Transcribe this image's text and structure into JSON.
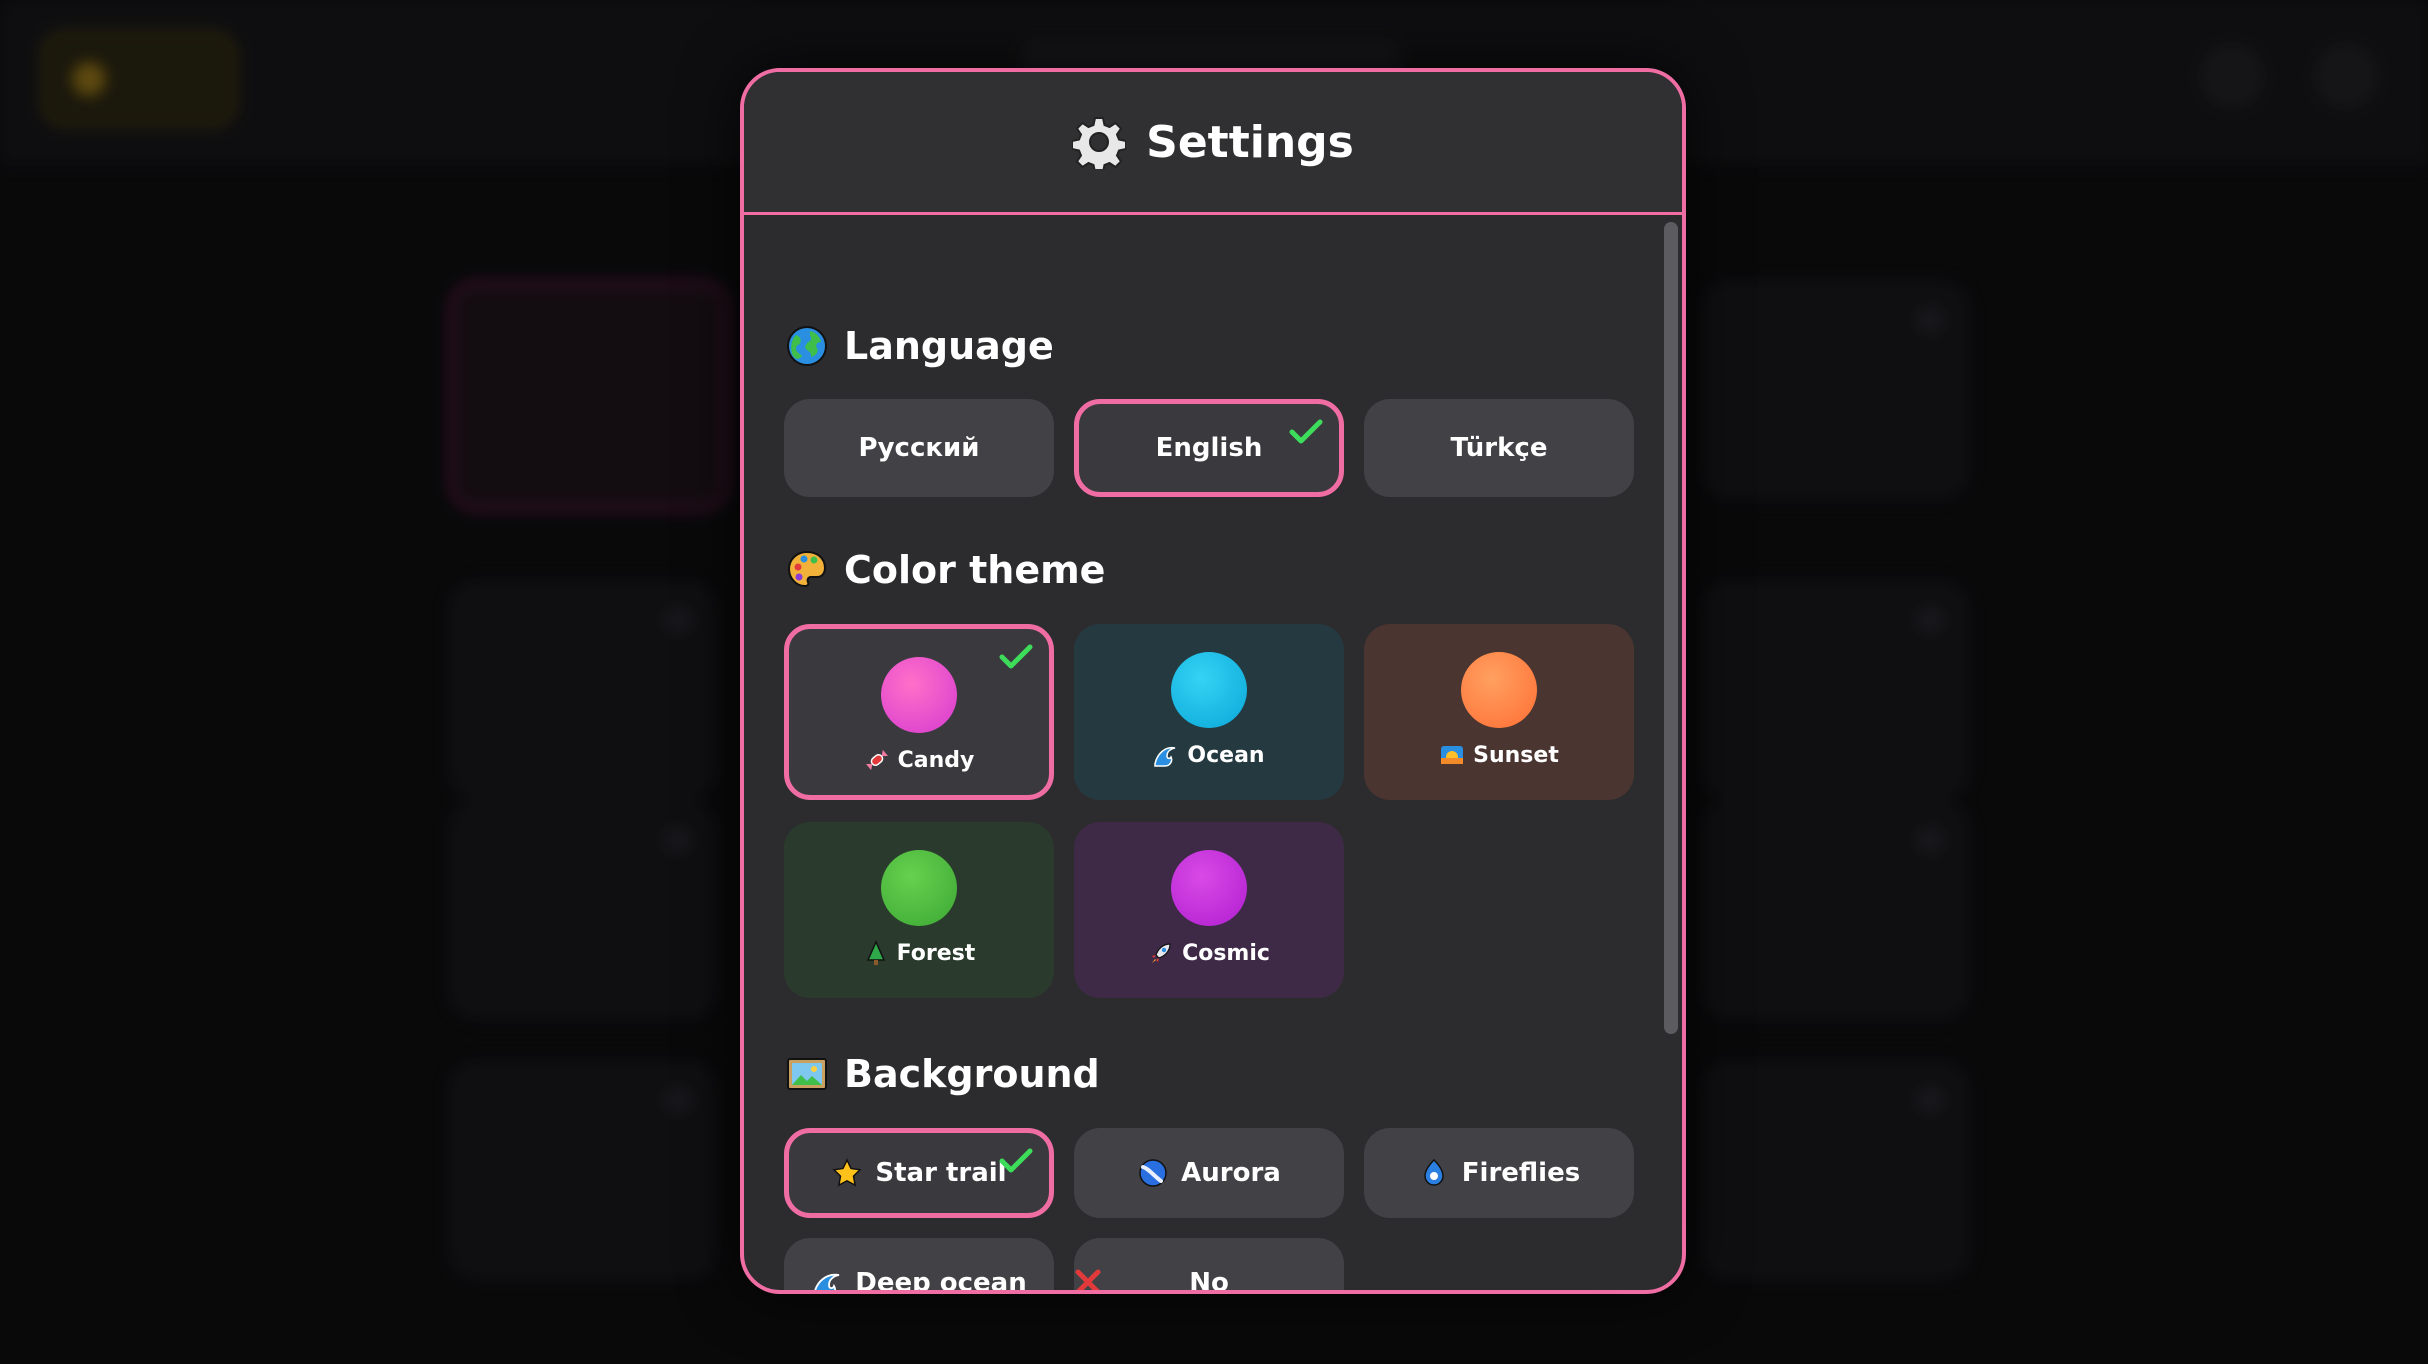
{
  "dialog": {
    "title": "Settings",
    "icon": "gear-icon",
    "accent_color": "#f06da4"
  },
  "language": {
    "title": "Language",
    "icon": "globe-icon",
    "options": [
      {
        "label": "Русский",
        "selected": false
      },
      {
        "label": "English",
        "selected": true
      },
      {
        "label": "Türkçe",
        "selected": false
      }
    ]
  },
  "theme": {
    "title": "Color theme",
    "icon": "palette-icon",
    "options": [
      {
        "label": "Candy",
        "icon": "candy-icon",
        "color": "#e040c8",
        "card_bg": "#3a3a3e",
        "selected": true
      },
      {
        "label": "Ocean",
        "icon": "wave-icon",
        "color": "#12b8e6",
        "card_bg": "#243a40",
        "selected": false
      },
      {
        "label": "Sunset",
        "icon": "sunset-icon",
        "color": "#ff7a3a",
        "card_bg": "#4a3530",
        "selected": false
      },
      {
        "label": "Forest",
        "icon": "tree-icon",
        "color": "#4cc03c",
        "card_bg": "#2a3a2c",
        "selected": false
      },
      {
        "label": "Cosmic",
        "icon": "rocket-icon",
        "color": "#c02ad6",
        "card_bg": "#3e2a46",
        "selected": false
      }
    ]
  },
  "background": {
    "title": "Background",
    "icon": "picture-icon",
    "options": [
      {
        "label": "Star trail",
        "icon": "star-icon",
        "selected": true
      },
      {
        "label": "Aurora",
        "icon": "aurora-icon",
        "selected": false
      },
      {
        "label": "Fireflies",
        "icon": "firefly-icon",
        "selected": false
      },
      {
        "label": "Deep ocean",
        "icon": "wave-icon",
        "selected": false
      },
      {
        "label": "No background",
        "icon": "cross-icon",
        "selected": false
      }
    ]
  },
  "check_color": "#3ddc5a"
}
